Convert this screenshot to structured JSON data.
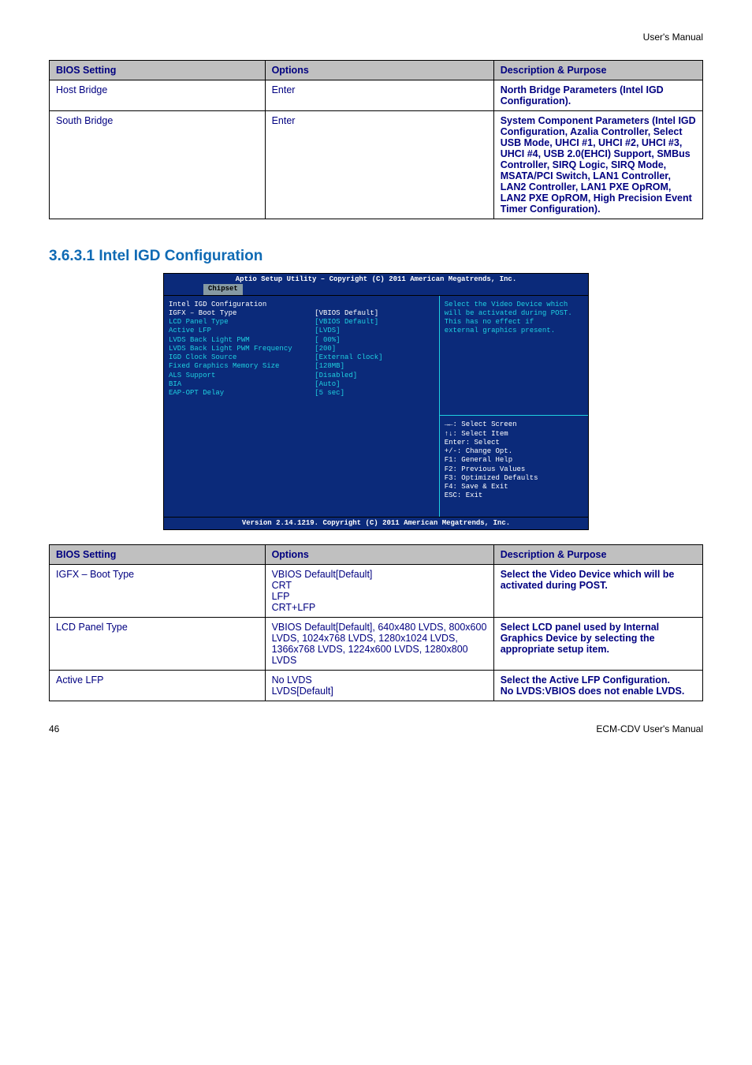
{
  "header": {
    "left": "",
    "right": "User's Manual"
  },
  "footer": {
    "left": "46",
    "right": "ECM-CDV User's Manual"
  },
  "table1": {
    "headers": [
      "BIOS Setting",
      "Options",
      "Description & Purpose"
    ],
    "rows": [
      {
        "c1": "Host Bridge",
        "c2": "Enter",
        "c3": "North Bridge Parameters (Intel IGD Configuration)."
      },
      {
        "c1": "South Bridge",
        "c2": "Enter",
        "c3": "System Component Parameters (Intel IGD Configuration, Azalia Controller, Select USB Mode, UHCI #1, UHCI #2, UHCI #3, UHCI #4, USB 2.0(EHCI) Support, SMBus Controller, SIRQ Logic, SIRQ Mode, MSATA/PCI Switch, LAN1 Controller, LAN2 Controller, LAN1 PXE OpROM, LAN2 PXE OpROM, High Precision Event Timer Configuration)."
      }
    ]
  },
  "section_title": "3.6.3.1 Intel IGD Configuration",
  "bios": {
    "title": "Aptio Setup Utility – Copyright (C) 2011 American Megatrends, Inc.",
    "tab": "Chipset",
    "heading": "Intel IGD Configuration",
    "items": [
      {
        "label": "IGFX – Boot Type",
        "value": "[VBIOS Default]",
        "selected": true
      },
      {
        "label": "LCD Panel Type",
        "value": "[VBIOS Default]"
      },
      {
        "label": "Active LFP",
        "value": "[LVDS]"
      },
      {
        "label": "LVDS Back Light PWM",
        "value": "[ 00%]"
      },
      {
        "label": "LVDS Back Light PWM Frequency",
        "value": "[200]"
      },
      {
        "label": "IGD Clock Source",
        "value": "[External Clock]"
      },
      {
        "label": "Fixed Graphics Memory Size",
        "value": "[128MB]"
      },
      {
        "label": "ALS Support",
        "value": "[Disabled]"
      },
      {
        "label": "BIA",
        "value": "[Auto]"
      },
      {
        "label": "EAP-OPT Delay",
        "value": "[5 sec]"
      }
    ],
    "help": [
      "Select the Video Device which",
      "will be activated during POST.",
      " This has no effect if",
      "external graphics present."
    ],
    "keys": [
      "→←: Select Screen",
      "↑↓: Select Item",
      "Enter: Select",
      "+/-: Change Opt.",
      "F1: General Help",
      "F2: Previous Values",
      "F3: Optimized Defaults",
      "F4: Save & Exit",
      "ESC: Exit"
    ],
    "version": "Version 2.14.1219. Copyright (C) 2011 American Megatrends, Inc."
  },
  "table2": {
    "headers": [
      "BIOS Setting",
      "Options",
      "Description & Purpose"
    ],
    "rows": [
      {
        "c1": "IGFX – Boot Type",
        "c2": "VBIOS Default[Default]\nCRT\nLFP\nCRT+LFP",
        "c3": "Select the Video Device which will be activated during POST."
      },
      {
        "c1": "LCD Panel Type",
        "c2": "VBIOS Default[Default], 640x480 LVDS, 800x600 LVDS, 1024x768 LVDS, 1280x1024 LVDS, 1366x768 LVDS, 1224x600 LVDS, 1280x800 LVDS",
        "c3": "Select LCD panel used by Internal Graphics Device by selecting the appropriate setup item."
      },
      {
        "c1": "Active LFP",
        "c2": "No LVDS\nLVDS[Default]",
        "c3": "Select the Active LFP Configuration.\nNo LVDS:VBIOS does not enable LVDS."
      }
    ]
  }
}
